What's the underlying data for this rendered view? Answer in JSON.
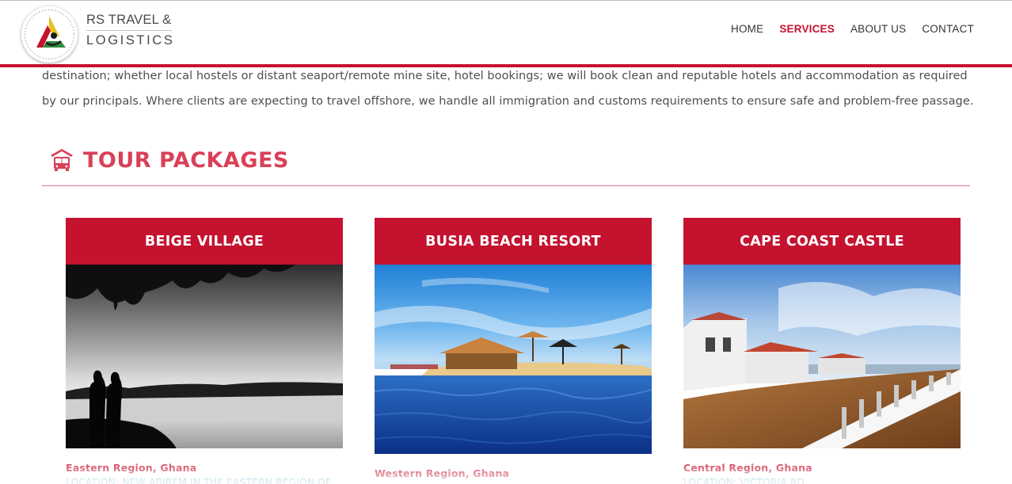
{
  "brand": {
    "line1": "RS TRAVEL &",
    "line2": "LOGISTICS",
    "colors": {
      "red": "#c4122f",
      "yellow": "#e8c21e",
      "green": "#2f8a3a",
      "black": "#1a1a1a"
    }
  },
  "nav": {
    "items": [
      {
        "label": "HOME",
        "active": false
      },
      {
        "label": "SERVICES",
        "active": true
      },
      {
        "label": "ABOUT US",
        "active": false
      },
      {
        "label": "CONTACT",
        "active": false
      }
    ]
  },
  "intro": {
    "text": "destination; whether local hostels or distant seaport/remote mine site, hotel bookings; we will book clean and reputable hotels and accommodation as required by our principals. Where clients are expecting to travel offshore, we handle all immigration and customs requirements to ensure safe and problem-free passage."
  },
  "section": {
    "icon": "bus-icon",
    "title": "TOUR PACKAGES"
  },
  "packages": [
    {
      "title": "BEIGE VILLAGE",
      "image": "lake-silhouette-photo",
      "region": "Eastern Region, Ghana",
      "location": "LOCATION: NEW ABIREM IN THE EASTERN REGION OF"
    },
    {
      "title": "BUSIA BEACH RESORT",
      "image": "beach-resort-photo",
      "region": "Western Region, Ghana",
      "location": ""
    },
    {
      "title": "CAPE COAST CASTLE",
      "image": "castle-photo",
      "region": "Central Region, Ghana",
      "location": "LOCATION: VICTORIA RD"
    }
  ],
  "theme": {
    "accent": "#c4122f",
    "heading": "#d94058",
    "location_text": "#3aa0b8",
    "body_text": "#4f4f4f"
  }
}
